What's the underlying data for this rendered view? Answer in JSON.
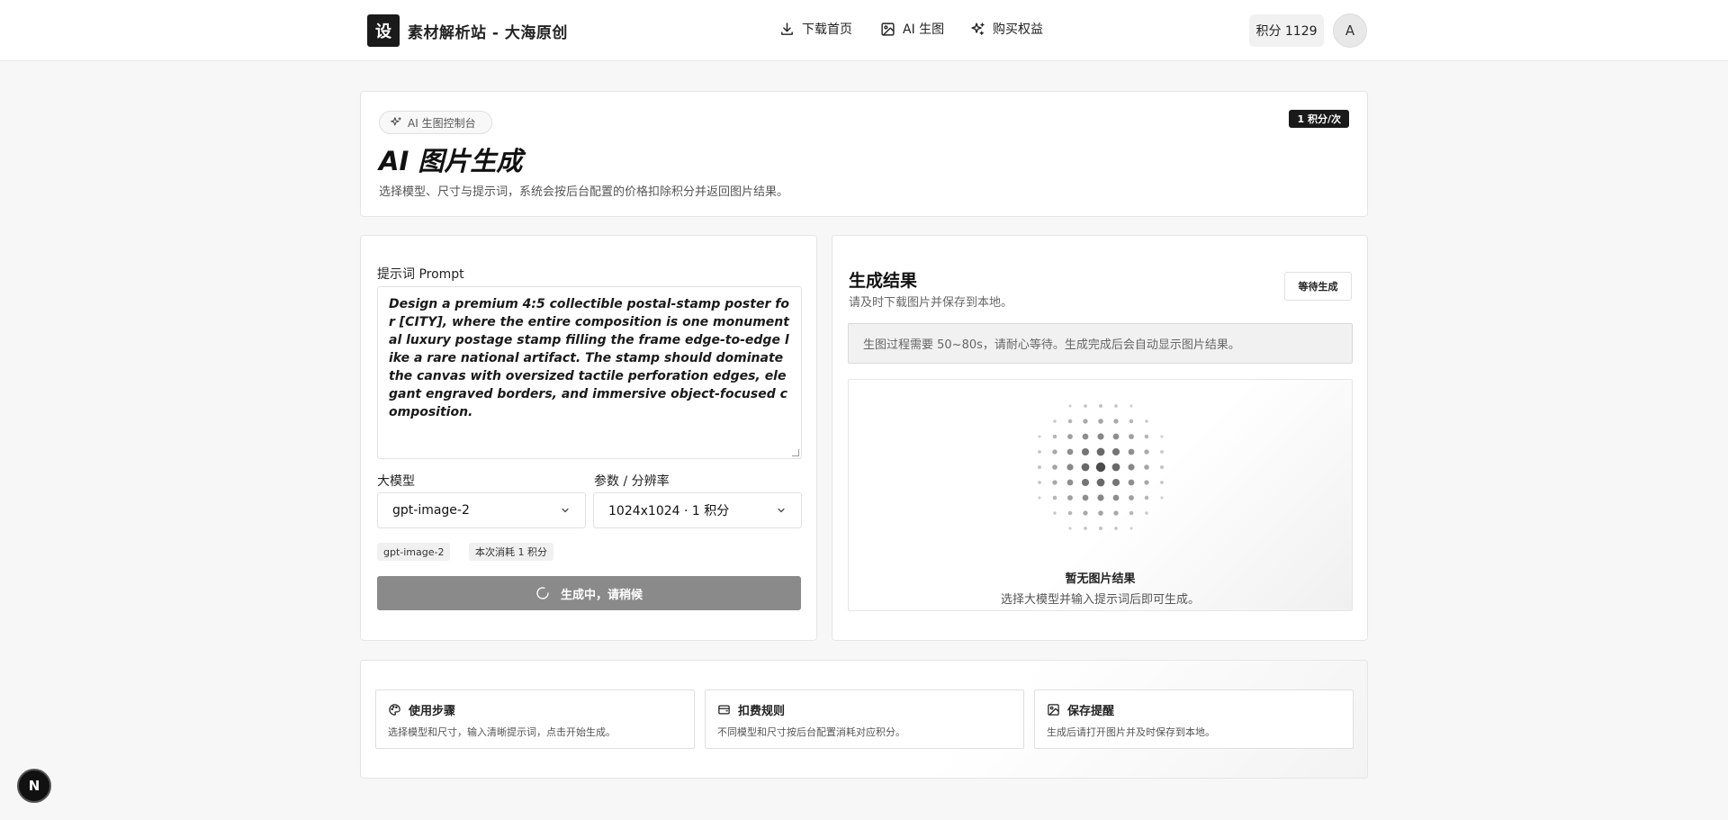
{
  "header": {
    "logo_char": "设",
    "site_name": "素材解析站 - 大海原创",
    "nav": [
      {
        "label": "下载首页",
        "icon": "download-icon"
      },
      {
        "label": "AI 生图",
        "icon": "image-icon"
      },
      {
        "label": "购买权益",
        "icon": "sparkles-icon"
      }
    ],
    "points": "积分 1129",
    "avatar": "A"
  },
  "intro": {
    "chip": "AI 生图控制台",
    "rate_badge": "1 积分/次",
    "title": "AI 图片生成",
    "description": "选择模型、尺寸与提示词，系统会按后台配置的价格扣除积分并返回图片结果。"
  },
  "form": {
    "prompt_label": "提示词 Prompt",
    "prompt_value": "Design a premium 4:5 collectible postal-stamp poster for [CITY], where the entire composition is one monumental luxury postage stamp filling the frame edge-to-edge like a rare national artifact. The stamp should dominate the canvas with oversized tactile perforation edges, elegant engraved borders, and immersive object-focused composition.",
    "model_label": "大模型",
    "model_value": "gpt-image-2",
    "params_label": "参数 / 分辨率",
    "params_value": "1024x1024 · 1 积分",
    "tags": [
      "gpt-image-2",
      "本次消耗 1 积分"
    ],
    "generate_button": "生成中，请稍候"
  },
  "result": {
    "title": "生成结果",
    "subtitle": "请及时下载图片并保存到本地。",
    "wait_button": "等待生成",
    "notice": "生图过程需要 50~80s，请耐心等待。生成完成后会自动显示图片结果。",
    "empty_title": "暂无图片结果",
    "empty_sub": "选择大模型并输入提示词后即可生成。"
  },
  "tips": [
    {
      "title": "使用步骤",
      "body": "选择模型和尺寸，输入清晰提示词，点击开始生成。",
      "icon": "palette-icon"
    },
    {
      "title": "扣费规则",
      "body": "不同模型和尺寸按后台配置消耗对应积分。",
      "icon": "wallet-icon"
    },
    {
      "title": "保存提醒",
      "body": "生成后请打开图片并及时保存到本地。",
      "icon": "image-save-icon"
    }
  ],
  "floating": {
    "label": "N"
  }
}
